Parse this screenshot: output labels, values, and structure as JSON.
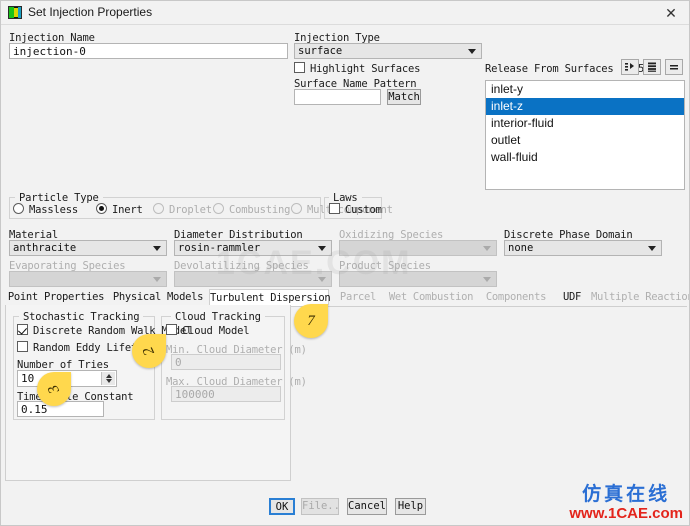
{
  "window": {
    "title": "Set Injection Properties",
    "icon": "fluent-app-icon",
    "close_label": "✕"
  },
  "injection": {
    "name_label": "Injection Name",
    "name_value": "injection-0",
    "type_label": "Injection Type",
    "type_value": "surface",
    "highlight_surfaces_label": "Highlight Surfaces",
    "highlight_surfaces_checked": false,
    "surface_name_pattern_label": "Surface Name Pattern",
    "surface_name_pattern_value": "",
    "match_label": "Match"
  },
  "release": {
    "label": "Release From Surfaces [1/5]",
    "items": [
      {
        "label": "inlet-y",
        "selected": false
      },
      {
        "label": "inlet-z",
        "selected": true
      },
      {
        "label": "interior-fluid",
        "selected": false
      },
      {
        "label": "outlet",
        "selected": false
      },
      {
        "label": "wall-fluid",
        "selected": false
      }
    ],
    "tool_buttons": [
      "filter-list-icon",
      "select-all-icon",
      "deselect-all-icon"
    ]
  },
  "particle_type": {
    "group_label": "Particle Type",
    "options": [
      {
        "label": "Massless",
        "selected": false,
        "disabled": false
      },
      {
        "label": "Inert",
        "selected": true,
        "disabled": false
      },
      {
        "label": "Droplet",
        "selected": false,
        "disabled": true
      },
      {
        "label": "Combusting",
        "selected": false,
        "disabled": true
      },
      {
        "label": "Multicomponent",
        "selected": false,
        "disabled": true
      }
    ]
  },
  "laws": {
    "group_label": "Laws",
    "custom_label": "Custom",
    "custom_checked": false
  },
  "selectors": {
    "material_label": "Material",
    "material_value": "anthracite",
    "diameter_distribution_label": "Diameter Distribution",
    "diameter_distribution_value": "rosin-rammler",
    "oxidizing_species_label": "Oxidizing Species",
    "oxidizing_species_value": "",
    "discrete_phase_domain_label": "Discrete Phase Domain",
    "discrete_phase_domain_value": "none",
    "evaporating_species_label": "Evaporating Species",
    "evaporating_species_value": "",
    "devolatilizing_species_label": "Devolatilizing Species",
    "devolatilizing_species_value": "",
    "product_species_label": "Product Species",
    "product_species_value": ""
  },
  "tabs": [
    {
      "label": "Point Properties",
      "active": false,
      "disabled": false
    },
    {
      "label": "Physical Models",
      "active": false,
      "disabled": false
    },
    {
      "label": "Turbulent Dispersion",
      "active": true,
      "disabled": false
    },
    {
      "label": "Parcel",
      "active": false,
      "disabled": true
    },
    {
      "label": "Wet Combustion",
      "active": false,
      "disabled": true
    },
    {
      "label": "Components",
      "active": false,
      "disabled": true
    },
    {
      "label": "UDF",
      "active": false,
      "disabled": false
    },
    {
      "label": "Multiple Reactions",
      "active": false,
      "disabled": true
    }
  ],
  "stochastic_tracking": {
    "group_label": "Stochastic Tracking",
    "drw_label": "Discrete Random Walk Model",
    "drw_checked": true,
    "rel_label": "Random Eddy Lifetime",
    "rel_checked": false,
    "number_of_tries_label": "Number of Tries",
    "number_of_tries_value": "10",
    "time_scale_constant_label": "Time Scale Constant",
    "time_scale_constant_value": "0.15"
  },
  "cloud_tracking": {
    "group_label": "Cloud Tracking",
    "cloud_model_label": "Cloud Model",
    "cloud_model_checked": false,
    "min_diameter_label": "Min. Cloud Diameter (m)",
    "min_diameter_value": "0",
    "max_diameter_label": "Max. Cloud Diameter (m)",
    "max_diameter_value": "100000"
  },
  "callouts": [
    {
      "number": "7"
    },
    {
      "number": "2"
    },
    {
      "number": "3"
    }
  ],
  "footer": {
    "ok_label": "OK",
    "file_label": "File...",
    "cancel_label": "Cancel",
    "help_label": "Help"
  },
  "watermark": {
    "center": "1CAE.COM",
    "cn": "仿真在线",
    "en": "www.1CAE.com"
  },
  "colors": {
    "selection_blue": "#0a72c4",
    "callout_yellow": "#ffd84d",
    "focus_blue": "#2a7fd4",
    "watermark_blue": "#2b6fd4",
    "watermark_red": "#e3241b"
  }
}
